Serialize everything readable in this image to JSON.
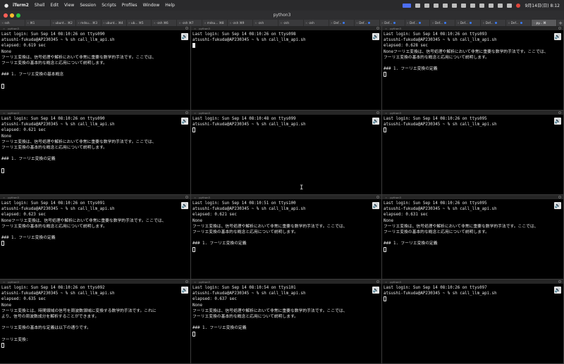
{
  "menubar": {
    "apple": "",
    "items": [
      "iTerm2",
      "Shell",
      "Edit",
      "View",
      "Session",
      "Scripts",
      "Profiles",
      "Window",
      "Help"
    ],
    "clock": "9月14日(日) 8:12"
  },
  "window": {
    "title": "python3"
  },
  "tabs": [
    {
      "label": "ssh",
      "dot": false
    },
    {
      "label": "⌘1",
      "dot": false
    },
    {
      "label": "ubunt... ⌘2",
      "dot": false
    },
    {
      "label": "mdsu... ⌘3",
      "dot": false
    },
    {
      "label": "ubunt... ⌘4",
      "dot": false
    },
    {
      "label": "ub... ⌘5",
      "dot": false
    },
    {
      "label": "-zsh ⌘6",
      "dot": false
    },
    {
      "label": "-zsh ⌘7",
      "dot": false
    },
    {
      "label": "mdsu... ⌘8",
      "dot": false
    },
    {
      "label": "-zsh ⌘9",
      "dot": false
    },
    {
      "label": "-zsh",
      "dot": false
    },
    {
      "label": "-zsh",
      "dot": false
    },
    {
      "label": "-zsh",
      "dot": false
    },
    {
      "label": "Def...",
      "dot": true
    },
    {
      "label": "Def...",
      "dot": true
    },
    {
      "label": "Def...",
      "dot": true
    },
    {
      "label": "Def...",
      "dot": true
    },
    {
      "label": "Def...",
      "dot": true
    },
    {
      "label": "Def...",
      "dot": true
    },
    {
      "label": "Def...",
      "dot": true
    },
    {
      "label": "Def...",
      "dot": true
    },
    {
      "label": "py... ⌘",
      "dot": false,
      "active": true
    }
  ],
  "panes": [
    {
      "header": "python3",
      "lines": [
        "Last login: Sun Sep 14 08:10:26 on ttys090",
        "atsushi-fukuda@AP230345 ~ % sh call_llm_api.sh",
        "elapsed: 0.619 sec",
        "None",
        "フーリエ変換は、信号処理や解析において非常に重要な数学的手法です。ここでは、",
        "フーリエ変換の基本的な概念と応用について説明します。",
        "",
        "### 1. フーリエ変換の基本概念",
        "",
        ""
      ],
      "cursor_line": 9,
      "cursor_solid": false
    },
    {
      "header": "python3",
      "lines": [
        "Last login: Sun Sep 14 08:10:26 on ttys098",
        "atsushi-fukuda@AP230345 ~ % sh call_llm_api.sh",
        ""
      ],
      "cursor_line": 2,
      "cursor_solid": true
    },
    {
      "header": "python3",
      "lines": [
        "Last login: Sun Sep 14 08:10:26 on ttys093",
        "atsushi-fukuda@AP230345 ~ % sh call_llm_api.sh",
        "elapsed: 0.628 sec",
        "Noneフーリエ変換は、信号処理や解析において非常に重要な数学的手法です。ここでは、",
        "フーリエ変換の基本的な概念と応用について説明します。",
        "",
        "### 1. フーリエ変換の定義",
        ""
      ],
      "cursor_line": 7,
      "cursor_solid": false
    },
    {
      "header": "python3",
      "lines": [
        "Last login: Sun Sep 14 08:10:26 on ttys090",
        "atsushi-fukuda@AP230345 ~ % sh call_llm_api.sh",
        "elapsed: 0.621 sec",
        "None",
        "フーリエ変換は、信号処理や解析において非常に重要な数学的手法です。ここでは、",
        "フーリエ変換の基本的な概念と応用について説明します。",
        "",
        "### 1. フーリエ変換の定義",
        "",
        ""
      ],
      "cursor_line": 9,
      "cursor_solid": false
    },
    {
      "header": "python3",
      "lines": [
        "Last login: Sun Sep 14 08:10:48 on ttys099",
        "atsushi-fukuda@AP230345 ~ % sh call_llm_api.sh",
        ""
      ],
      "cursor_line": 2,
      "cursor_solid": false
    },
    {
      "header": "python3",
      "lines": [
        "Last login: Sun Sep 14 08:10:26 on ttys095",
        "atsushi-fukuda@AP230345 ~ % sh call_llm_api.sh",
        ""
      ],
      "cursor_line": 2,
      "cursor_solid": false
    },
    {
      "header": "python3",
      "lines": [
        "Last login: Sun Sep 14 08:10:26 on ttys091",
        "atsushi-fukuda@AP230345 ~ % sh call_llm_api.sh",
        "elapsed: 0.623 sec",
        "Noneフーリエ変換は、信号処理や解析において非常に重要な数学的手法です。ここでは、",
        "フーリエ変換の基本的な概念と応用について説明します。",
        "",
        "### 1. フーリエ変換の定義",
        ""
      ],
      "cursor_line": 7,
      "cursor_solid": false
    },
    {
      "header": "python3",
      "lines": [
        "Last login: Sun Sep 14 08:10:51 on ttys100",
        "atsushi-fukuda@AP230345 ~ % sh call_llm_api.sh",
        "elapsed: 0.621 sec",
        "None",
        "フーリエ変換は、信号処理や解析において非常に重要な数学的手法です。ここでは、",
        "フーリエ変換の基本的な概念と応用について説明します。",
        "",
        "### 1. フーリエ変換の定義",
        ""
      ],
      "cursor_line": 8,
      "cursor_solid": false
    },
    {
      "header": "python3",
      "lines": [
        "Last login: Sun Sep 14 08:10:26 on ttys095",
        "atsushi-fukuda@AP230345 ~ % sh call_llm_api.sh",
        "elapsed: 0.631 sec",
        "None",
        "フーリエ変換は、信号処理や解析において非常に重要な数学的手法です。ここでは、",
        "フーリエ変換の基本的な概念と応用について説明します。",
        "",
        "### 1. フーリエ変換の定義",
        ""
      ],
      "cursor_line": 8,
      "cursor_solid": false
    },
    {
      "header": "python3",
      "lines": [
        "Last login: Sun Sep 14 08:10:26 on ttys092",
        "atsushi-fukuda@AP230345 ~ % sh call_llm_api.sh",
        "elapsed: 0.635 sec",
        "None",
        "フーリエ変換とは、時間領域の信号を周波数領域に変換する数学的手法です。これに",
        "より、信号の周波数成分を解析することができます。",
        "",
        "フーリエ変換の基本的な定義は以下の通りです。",
        "",
        "フーリエ変換:",
        ""
      ],
      "cursor_line": 10,
      "cursor_solid": false
    },
    {
      "header": "python3",
      "lines": [
        "Last login: Sun Sep 14 08:10:54 on ttys101",
        "atsushi-fukuda@AP230345 ~ % sh call_llm_api.sh",
        "elapsed: 0.637 sec",
        "None",
        "フーリエ変換は、信号処理や解析において非常に重要な数学的手法です。ここでは、",
        "フーリエ変換の基本的な概念と応用について説明します。",
        "",
        "### 1. フーリエ変換の定義",
        ""
      ],
      "cursor_line": 8,
      "cursor_solid": false
    },
    {
      "header": "python3",
      "lines": [
        "Last login: Sun Sep 14 08:10:26 on ttys097",
        "atsushi-fukuda@AP230345 ~ % sh call_llm_api.sh",
        ""
      ],
      "cursor_line": 2,
      "cursor_solid": false
    }
  ]
}
